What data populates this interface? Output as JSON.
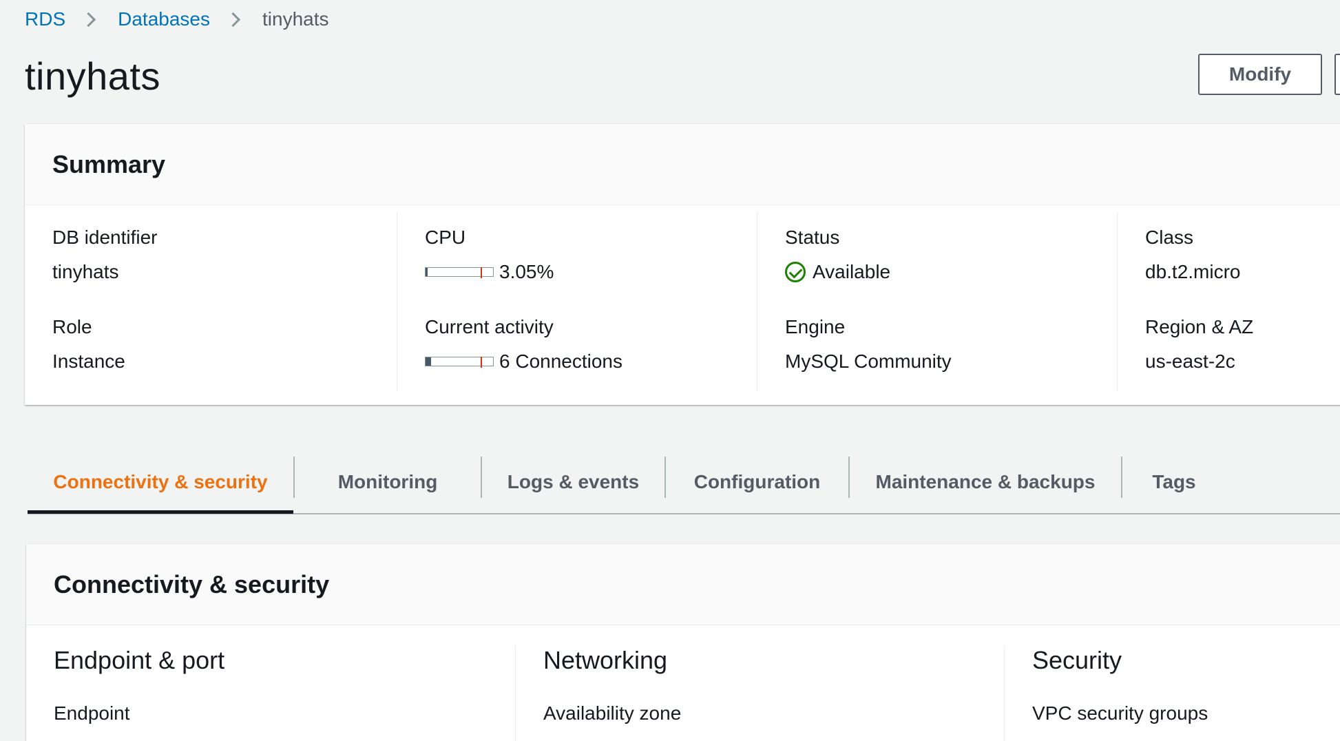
{
  "breadcrumb": {
    "items": [
      {
        "label": "RDS"
      },
      {
        "label": "Databases"
      },
      {
        "label": "tinyhats"
      }
    ]
  },
  "header": {
    "title": "tinyhats",
    "modify_label": "Modify"
  },
  "summary": {
    "title": "Summary",
    "db_identifier": {
      "label": "DB identifier",
      "value": "tinyhats"
    },
    "role": {
      "label": "Role",
      "value": "Instance"
    },
    "cpu": {
      "label": "CPU",
      "value": "3.05%",
      "fill_percent": 3.05
    },
    "current_activity": {
      "label": "Current activity",
      "value": "6 Connections",
      "fill_percent": 8
    },
    "status": {
      "label": "Status",
      "value": "Available"
    },
    "engine": {
      "label": "Engine",
      "value": "MySQL Community"
    },
    "class": {
      "label": "Class",
      "value": "db.t2.micro"
    },
    "region_az": {
      "label": "Region & AZ",
      "value": "us-east-2c"
    }
  },
  "tabs": [
    {
      "label": "Connectivity & security",
      "active": true
    },
    {
      "label": "Monitoring",
      "active": false
    },
    {
      "label": "Logs & events",
      "active": false
    },
    {
      "label": "Configuration",
      "active": false
    },
    {
      "label": "Maintenance & backups",
      "active": false
    },
    {
      "label": "Tags",
      "active": false
    }
  ],
  "connectivity": {
    "title": "Connectivity & security",
    "sections": [
      {
        "title": "Endpoint & port",
        "first_field": "Endpoint"
      },
      {
        "title": "Networking",
        "first_field": "Availability zone"
      },
      {
        "title": "Security",
        "first_field": "VPC security groups"
      }
    ]
  },
  "colors": {
    "link": "#0073bb",
    "active_tab": "#ec7211",
    "status_available": "#1d8102",
    "meter_fill": "#44576b",
    "meter_threshold": "#d13212"
  }
}
